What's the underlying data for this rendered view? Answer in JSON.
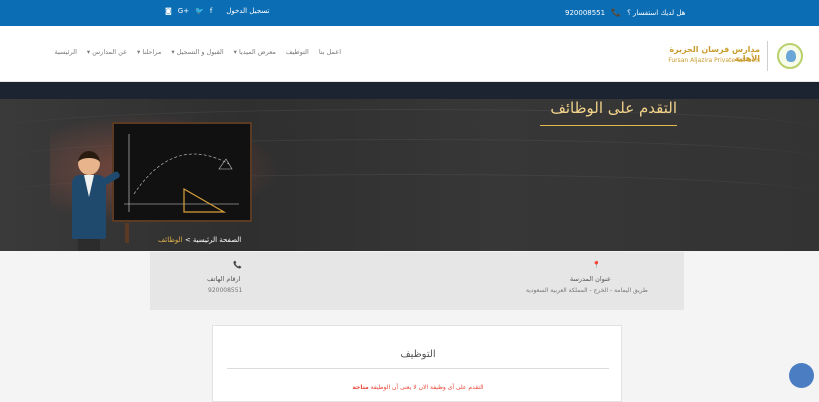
{
  "topbar": {
    "question": "هل لديك استفسار ؟",
    "phone": "920008551",
    "register": "تسجيل الدخول",
    "social_icons": [
      "facebook-icon",
      "twitter-icon",
      "google-plus-icon",
      "instagram-icon"
    ],
    "social_glyphs": [
      "f",
      "🐦",
      "G+",
      "◙"
    ]
  },
  "brand": {
    "title_ar": "مدارس فرسان الجزيرة الأهلية",
    "title_en": "Fursan Aljazira Private Schools",
    "color": "#c89b2c"
  },
  "nav": {
    "items": [
      {
        "label": "الرئيسية"
      },
      {
        "label": "عن المدارس ▾"
      },
      {
        "label": "مراحلنا ▾"
      },
      {
        "label": "القبول و التسجيل ▾"
      },
      {
        "label": "معرض الميديا ▾"
      },
      {
        "label": "التوظيف"
      },
      {
        "label": "اعمل بنا"
      }
    ]
  },
  "hero": {
    "title": "التقدم على الوظائف",
    "breadcrumb_home": "الصفحة الرئيسية",
    "breadcrumb_sep": " > ",
    "breadcrumb_current": "الوظائف"
  },
  "info": {
    "address_label": "عنوان المدرسة",
    "address_value": "طريق اليمامة - الخرج - المملكة العربية السعودية",
    "phone_label": "ارقام الهاتف",
    "phone_value": "920008551"
  },
  "card": {
    "title": "التوظيف",
    "note": "التقدم على أى وظيفة الان لا يعنى أن الوظيفة ",
    "note_strong": "متاحة"
  },
  "colors": {
    "topbar": "#0b6db4",
    "accent_gold": "#e1b94d",
    "alert": "#e94a3a",
    "fab": "#4b7dc3"
  }
}
